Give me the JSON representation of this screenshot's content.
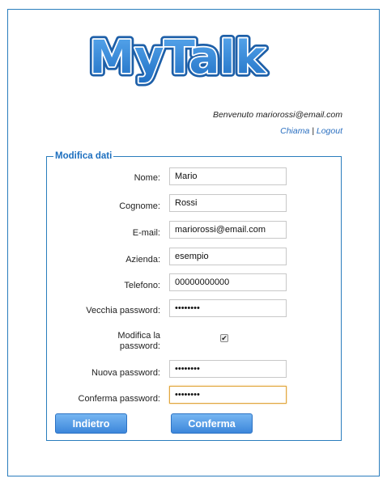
{
  "logo": {
    "text": "MyTalk"
  },
  "header": {
    "welcome": "Benvenuto mariorossi@email.com",
    "call_link": "Chiama",
    "separator": "|",
    "logout_link": "Logout"
  },
  "form": {
    "legend": "Modifica dati",
    "nome": {
      "label": "Nome:",
      "value": "Mario"
    },
    "cognome": {
      "label": "Cognome:",
      "value": "Rossi"
    },
    "email": {
      "label": "E-mail:",
      "value": "mariorossi@email.com"
    },
    "azienda": {
      "label": "Azienda:",
      "value": "esempio"
    },
    "telefono": {
      "label": "Telefono:",
      "value": "00000000000"
    },
    "old_password": {
      "label": "Vecchia password:",
      "value": "••••••••"
    },
    "change_password": {
      "label_line1": "Modifica la",
      "label_line2": "password:",
      "checked": true,
      "check_glyph": "✔"
    },
    "new_password": {
      "label": "Nuova password:",
      "value": "••••••••"
    },
    "confirm_password": {
      "label": "Conferma password:",
      "value": "••••••••"
    },
    "back_button": "Indietro",
    "confirm_button": "Conferma"
  },
  "colors": {
    "accent": "#2a7dbd",
    "button_top": "#76b6f2",
    "button_bottom": "#3c86db",
    "focus_border": "#e0a63d"
  }
}
